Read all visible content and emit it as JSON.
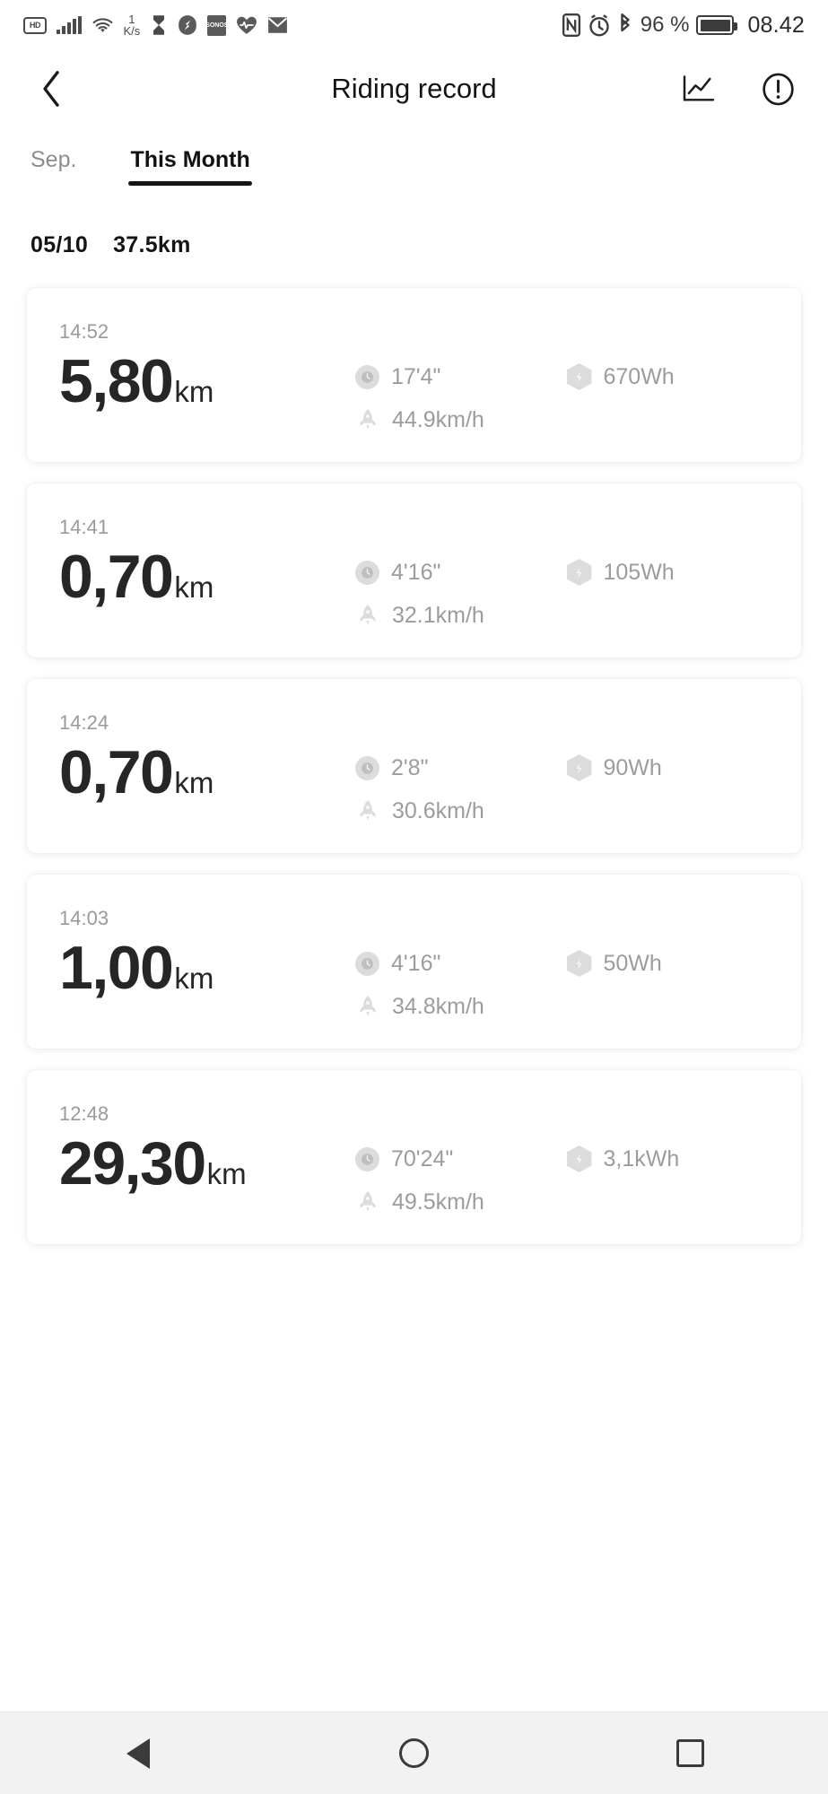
{
  "status_bar": {
    "hd_label": "HD",
    "network_speed_value": "1",
    "network_speed_unit": "K/s",
    "battery_percent": "96 %",
    "time": "08.42",
    "left_icons": [
      "hd-badge",
      "signal-bars-icon",
      "wifi-icon",
      "data-speed-indicator",
      "hourglass-icon",
      "app-icon-compass",
      "app-icon-sonos",
      "heart-rate-icon",
      "mail-icon"
    ],
    "right_icons": [
      "nfc-icon",
      "alarm-icon",
      "bluetooth-icon",
      "battery-icon"
    ]
  },
  "app_bar": {
    "title": "Riding record",
    "back_icon": "chevron-left-icon",
    "chart_icon": "line-chart-icon",
    "info_icon": "info-circle-icon"
  },
  "tabs": [
    {
      "label": "Sep.",
      "active": false
    },
    {
      "label": "This Month",
      "active": true
    }
  ],
  "summary": {
    "date": "05/10",
    "distance": "37.5km"
  },
  "records": [
    {
      "time": "14:52",
      "distance_value": "5,80",
      "distance_unit": "km",
      "duration": "17'4\"",
      "energy": "670Wh",
      "speed": "44.9km/h"
    },
    {
      "time": "14:41",
      "distance_value": "0,70",
      "distance_unit": "km",
      "duration": "4'16\"",
      "energy": "105Wh",
      "speed": "32.1km/h"
    },
    {
      "time": "14:24",
      "distance_value": "0,70",
      "distance_unit": "km",
      "duration": "2'8\"",
      "energy": "90Wh",
      "speed": "30.6km/h"
    },
    {
      "time": "14:03",
      "distance_value": "1,00",
      "distance_unit": "km",
      "duration": "4'16\"",
      "energy": "50Wh",
      "speed": "34.8km/h"
    },
    {
      "time": "12:48",
      "distance_value": "29,30",
      "distance_unit": "km",
      "duration": "70'24\"",
      "energy": "3,1kWh",
      "speed": "49.5km/h"
    }
  ],
  "nav_bar": {
    "back_icon": "triangle-back-icon",
    "home_icon": "circle-home-icon",
    "recents_icon": "square-recents-icon"
  },
  "colors": {
    "text_primary": "#141414",
    "text_muted": "#9c9c9c",
    "icon_bg": "#dcdcdc",
    "nav_bg": "#f2f2f2"
  }
}
